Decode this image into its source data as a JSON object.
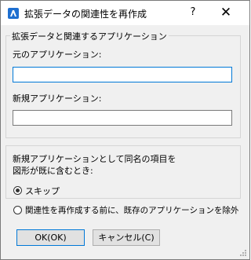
{
  "window": {
    "title": "拡張データの関連性を再作成",
    "help_glyph": "?",
    "close_glyph": "✕",
    "app_icon": "bricscad-app-icon"
  },
  "applications_group": {
    "legend": "拡張データと関連するアプリケーション",
    "source_label": "元のアプリケーション:",
    "source_value": "",
    "new_label": "新規アプリケーション:",
    "new_value": ""
  },
  "conflict_group": {
    "description_line1": "新規アプリケーションとして同名の項目を",
    "description_line2": "図形が既に含むとき:",
    "options": [
      {
        "label": "スキップ",
        "selected": true
      },
      {
        "label": "関連性を再作成する前に、既存のアプリケーションを除外",
        "selected": false
      }
    ]
  },
  "buttons": {
    "ok": "OK(OK)",
    "cancel": "キャンセル(C)"
  },
  "colors": {
    "dialog_background": "#f0f0f0",
    "titlebar_background": "#ffffff",
    "focus_accent": "#0078d7",
    "icon_blue": "#1e6fd0"
  }
}
